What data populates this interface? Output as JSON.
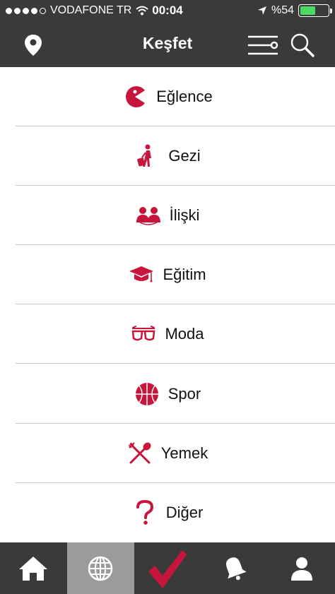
{
  "status_bar": {
    "carrier": "VODAFONE TR",
    "time": "00:04",
    "battery": "%54",
    "battery_level": 0.54
  },
  "nav": {
    "title": "Keşfet",
    "icons": [
      "location-pin-icon",
      "filter-icon",
      "search-icon"
    ]
  },
  "categories": [
    {
      "label": "Eğlence",
      "icon": "pacman-icon"
    },
    {
      "label": "Gezi",
      "icon": "traveler-icon"
    },
    {
      "label": "İlişki",
      "icon": "people-icon"
    },
    {
      "label": "Eğitim",
      "icon": "graduation-cap-icon"
    },
    {
      "label": "Moda",
      "icon": "sunglasses-icon"
    },
    {
      "label": "Spor",
      "icon": "basketball-icon"
    },
    {
      "label": "Yemek",
      "icon": "fork-spoon-icon"
    },
    {
      "label": "Diğer",
      "icon": "question-mark-icon"
    }
  ],
  "tabbar": {
    "tabs": [
      "home-icon",
      "globe-icon",
      "checkmark-icon",
      "bell-icon",
      "profile-icon"
    ],
    "active": "globe-icon"
  },
  "colors": {
    "accent": "#c8153c",
    "bar": "#3a3a3a",
    "active_tab": "#9b9b9b"
  }
}
